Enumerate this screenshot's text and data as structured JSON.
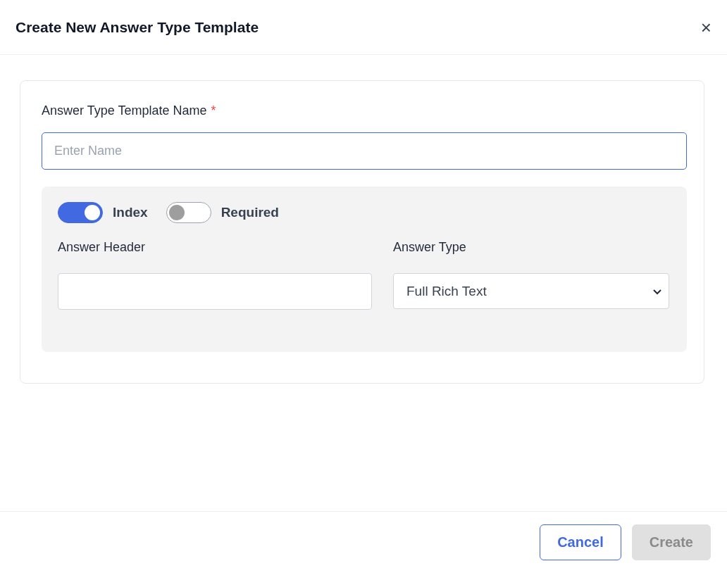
{
  "dialog": {
    "title": "Create New Answer Type Template",
    "close": "×"
  },
  "name_field": {
    "label": "Answer Type Template Name",
    "required_mark": "*",
    "placeholder": "Enter Name",
    "focused": true
  },
  "toggles": [
    {
      "label": "Index",
      "on": true
    },
    {
      "label": "Required",
      "on": false
    }
  ],
  "answer_header": {
    "label": "Answer Header"
  },
  "answer_type": {
    "label": "Answer Type",
    "value": "Full Rich Text"
  },
  "buttons": [
    {
      "label": "Cancel",
      "kind": "secondary",
      "disabled": false
    },
    {
      "label": "Create",
      "kind": "primary",
      "disabled": true
    }
  ]
}
